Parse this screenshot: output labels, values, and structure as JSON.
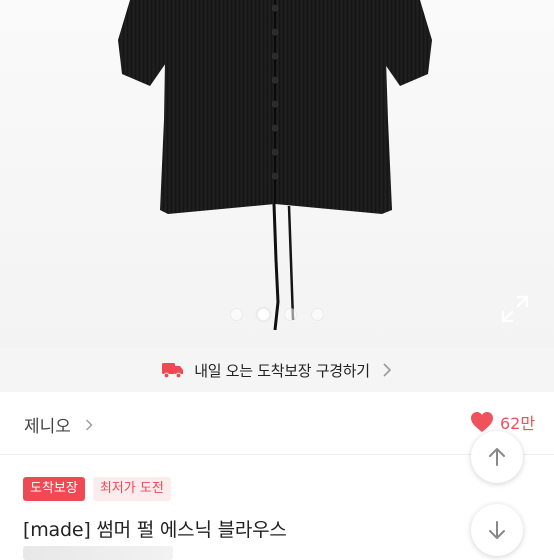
{
  "product_image": {
    "icon": "product-photo-black-blouse",
    "carousel_dot_count": 4,
    "carousel_active_index": 1,
    "expand_icon": "expand-icon"
  },
  "delivery_banner": {
    "text": "내일 오는 도착보장 구경하기",
    "icon": "truck-icon",
    "accent_color": "#ef4a54"
  },
  "shop": {
    "name": "제니오",
    "like_count": "62만",
    "like_color": "#f0525c"
  },
  "tags": {
    "primary": "도착보장",
    "secondary": "최저가 도전"
  },
  "product": {
    "title": "[made] 썸머 펄 에스닉 블라우스"
  }
}
